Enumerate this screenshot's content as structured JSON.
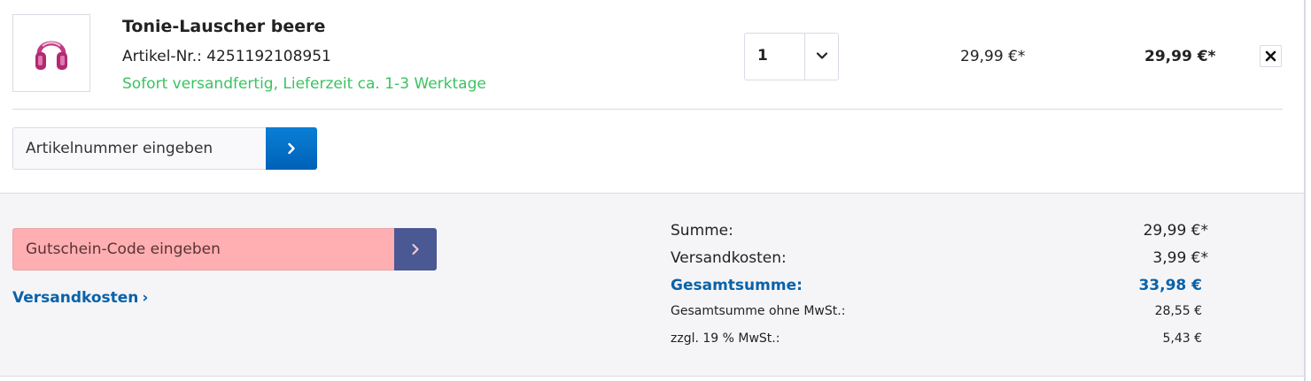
{
  "cart_item": {
    "name": "Tonie-Lauscher beere",
    "article_number": "Artikel-Nr.: 4251192108951",
    "delivery_status": "Sofort versandfertig, Lieferzeit ca. 1-3 Werktage",
    "quantity": "1",
    "unit_price": "29,99 €*",
    "total_price": "29,99 €*",
    "image_icon": "pink-headphones-icon",
    "remove_icon": "close-icon"
  },
  "add_article": {
    "placeholder": "Artikelnummer eingeben",
    "button_icon": "chevron-right-icon"
  },
  "voucher": {
    "placeholder": "Gutschein-Code eingeben",
    "button_icon": "chevron-right-icon"
  },
  "shipping_link": {
    "label": "Versandkosten",
    "arrow": "›"
  },
  "summary": {
    "subtotal_label": "Summe:",
    "subtotal_value": "29,99 €*",
    "shipping_label": "Versandkosten:",
    "shipping_value": "3,99 €*",
    "grand_total_label": "Gesamtsumme:",
    "grand_total_value": "33,98 €",
    "net_label": "Gesamtsumme ohne MwSt.:",
    "net_value": "28,55 €",
    "vat_label": "zzgl. 19 % MwSt.:",
    "vat_value": "5,43 €"
  },
  "colors": {
    "accent_blue": "#0862a9",
    "button_blue": "#0a7fd6",
    "voucher_button": "#4a5893",
    "delivery_green": "#3cc261",
    "voucher_highlight": "#ffafb2"
  }
}
